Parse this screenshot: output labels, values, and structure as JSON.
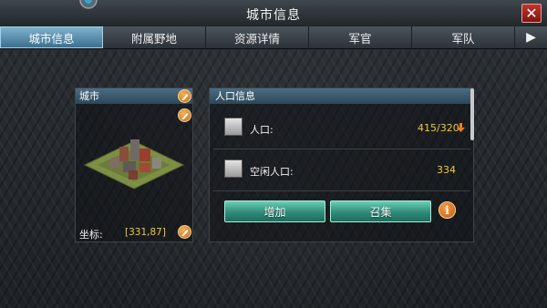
{
  "window": {
    "title": "城市信息",
    "close_icon": "close-icon",
    "close_label": "✕"
  },
  "tabs": [
    {
      "label": "城市信息",
      "active": true
    },
    {
      "label": "附属野地",
      "active": false
    },
    {
      "label": "资源详情",
      "active": false
    },
    {
      "label": "军官",
      "active": false
    },
    {
      "label": "军队",
      "active": false
    }
  ],
  "tab_scroll_arrow": "▶",
  "city_panel": {
    "title": "城市",
    "coord_label": "坐标:",
    "coord_value": "[331,87]",
    "edit_icon": "pencil-icon"
  },
  "population_panel": {
    "title": "人口信息",
    "rows": [
      {
        "label": "人口:",
        "value": "415/320",
        "trend": "down",
        "icon": "people-icon"
      },
      {
        "label": "空闲人口:",
        "value": "334",
        "icon": "people-icon"
      }
    ],
    "buttons": {
      "add_label": "增加",
      "recruit_label": "召集",
      "info_label": "i"
    }
  },
  "colors": {
    "accent_tab": "#5a94b4",
    "value_yellow": "#f0c838",
    "trend_down": "#f07a20",
    "button_green": "#2f8b78",
    "close_red": "#a8251f"
  }
}
